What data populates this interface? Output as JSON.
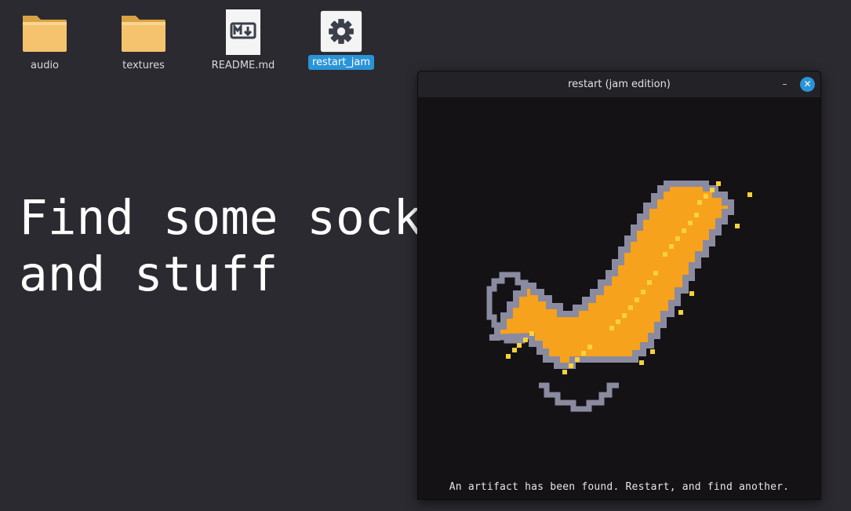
{
  "desktop": {
    "icons": [
      {
        "label": "audio",
        "icon": "folder-icon"
      },
      {
        "label": "textures",
        "icon": "folder-icon"
      },
      {
        "label": "README.md",
        "icon": "markdown-file-icon"
      },
      {
        "label": "restart_jam",
        "icon": "gear-icon",
        "selected": true
      }
    ],
    "headline": [
      "Find some socks",
      "and stuff"
    ]
  },
  "window": {
    "title": "restart (jam edition)",
    "minimize_symbol": "–",
    "close_symbol": "✕",
    "caption": "An artifact has been found. Restart, and find another.",
    "artifact_icon": "sock-artifact-icon"
  },
  "colors": {
    "desktop_bg": "#2b2a30",
    "selection": "#2a94d8",
    "sock_fill": "#f6a21c",
    "sock_highlight": "#f9d23a",
    "sock_outline": "#8a8aa0",
    "game_bg": "#141215"
  }
}
